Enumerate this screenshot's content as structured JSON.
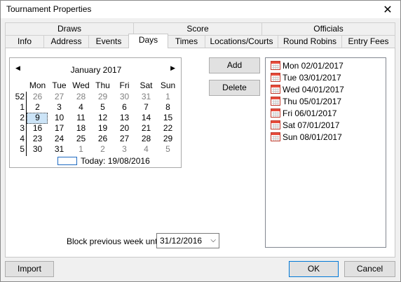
{
  "window": {
    "title": "Tournament Properties",
    "close_glyph": "✕"
  },
  "tabs_row1": [
    "Draws",
    "Score",
    "Officials"
  ],
  "tabs_row2": [
    "Info",
    "Address",
    "Events",
    "Days",
    "Times",
    "Locations/Courts",
    "Round Robins",
    "Entry Fees"
  ],
  "active_tab": "Days",
  "calendar": {
    "month_label": "January 2017",
    "prev_glyph": "◀",
    "next_glyph": "▶",
    "day_names": [
      "Mon",
      "Tue",
      "Wed",
      "Thu",
      "Fri",
      "Sat",
      "Sun"
    ],
    "weeks": [
      {
        "week": "52",
        "days": [
          "26",
          "27",
          "28",
          "29",
          "30",
          "31",
          "1"
        ]
      },
      {
        "week": "1",
        "days": [
          "2",
          "3",
          "4",
          "5",
          "6",
          "7",
          "8"
        ]
      },
      {
        "week": "2",
        "days": [
          "9",
          "10",
          "11",
          "12",
          "13",
          "14",
          "15"
        ]
      },
      {
        "week": "3",
        "days": [
          "16",
          "17",
          "18",
          "19",
          "20",
          "21",
          "22"
        ]
      },
      {
        "week": "4",
        "days": [
          "23",
          "24",
          "25",
          "26",
          "27",
          "28",
          "29"
        ]
      },
      {
        "week": "5",
        "days": [
          "30",
          "31",
          "1",
          "2",
          "3",
          "4",
          "5"
        ]
      }
    ],
    "selected_day": "9",
    "today_label": "Today: 19/08/2016"
  },
  "buttons": {
    "add": "Add",
    "delete": "Delete",
    "import": "Import",
    "ok": "OK",
    "cancel": "Cancel"
  },
  "days_list": [
    "Mon 02/01/2017",
    "Tue 03/01/2017",
    "Wed 04/01/2017",
    "Thu 05/01/2017",
    "Fri 06/01/2017",
    "Sat 07/01/2017",
    "Sun 08/01/2017"
  ],
  "block": {
    "label": "Block previous week until:",
    "value": "31/12/2016",
    "arrow_glyph": "⌵"
  }
}
